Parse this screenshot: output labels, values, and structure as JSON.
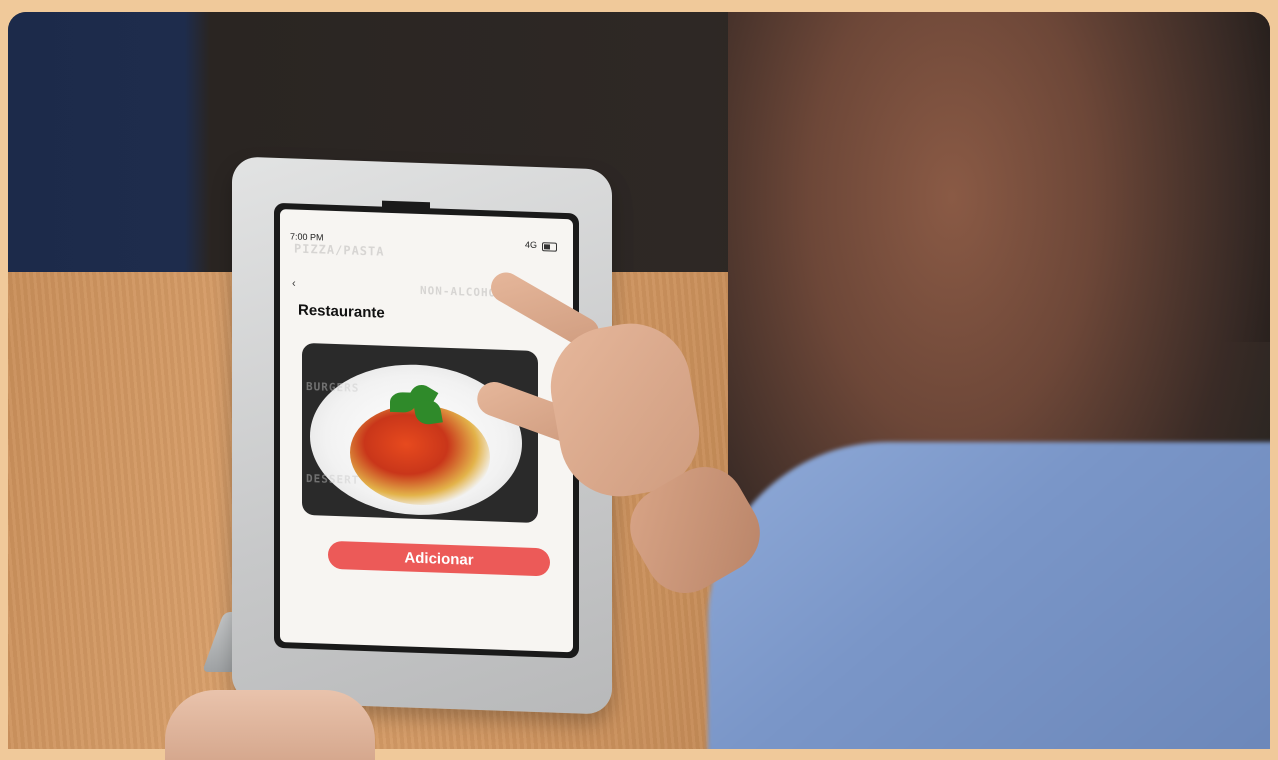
{
  "photo": {
    "subject": "person using tablet kiosk on wooden table",
    "colors": {
      "border": "#f0c99a",
      "button": "#ec5a58",
      "shirt": "#7a96c8"
    }
  },
  "screen": {
    "status_time": "7:00 PM",
    "status_signal": "4G",
    "title": "Restaurante",
    "add_button": "Adicionar",
    "background_labels": [
      "PIZZA/PASTA",
      "NON-ALCOHOLIC",
      "BURGERS",
      "DESSERT"
    ]
  }
}
